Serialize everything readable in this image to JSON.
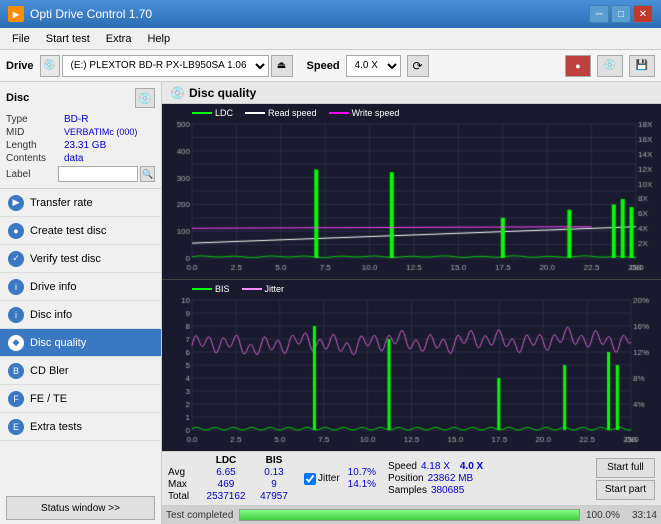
{
  "titleBar": {
    "title": "Opti Drive Control 1.70",
    "icon": "ODC",
    "controls": [
      "minimize",
      "maximize",
      "close"
    ]
  },
  "menuBar": {
    "items": [
      "File",
      "Start test",
      "Extra",
      "Help"
    ]
  },
  "driveBar": {
    "label": "Drive",
    "driveValue": "(E:)  PLEXTOR BD-R  PX-LB950SA 1.06",
    "speedLabel": "Speed",
    "speedValue": "4.0 X"
  },
  "discPanel": {
    "title": "Disc",
    "fields": [
      {
        "label": "Type",
        "value": "BD-R",
        "color": "blue"
      },
      {
        "label": "MID",
        "value": "VERBATIMc (000)",
        "color": "blue"
      },
      {
        "label": "Length",
        "value": "23.31 GB",
        "color": "blue"
      },
      {
        "label": "Contents",
        "value": "data",
        "color": "blue"
      },
      {
        "label": "Label",
        "value": "",
        "type": "input"
      }
    ]
  },
  "navItems": [
    {
      "label": "Transfer rate",
      "icon": "▶"
    },
    {
      "label": "Create test disc",
      "icon": "●"
    },
    {
      "label": "Verify test disc",
      "icon": "✓"
    },
    {
      "label": "Drive info",
      "icon": "i"
    },
    {
      "label": "Disc info",
      "icon": "i"
    },
    {
      "label": "Disc quality",
      "icon": "◆",
      "active": true
    },
    {
      "label": "CD Bler",
      "icon": "B"
    },
    {
      "label": "FE / TE",
      "icon": "F"
    },
    {
      "label": "Extra tests",
      "icon": "E"
    }
  ],
  "statusBtn": "Status window >>",
  "discQuality": {
    "title": "Disc quality",
    "legend1": [
      {
        "label": "LDC",
        "color": "#00ff00"
      },
      {
        "label": "Read speed",
        "color": "#ffffff"
      },
      {
        "label": "Write speed",
        "color": "#ff00ff"
      }
    ],
    "legend2": [
      {
        "label": "BIS",
        "color": "#00ff00"
      },
      {
        "label": "Jitter",
        "color": "#ff88ff"
      }
    ]
  },
  "statsBar": {
    "columns": [
      {
        "header": "LDC",
        "avg": "6.65",
        "max": "469",
        "total": "2537162"
      },
      {
        "header": "BIS",
        "avg": "0.13",
        "max": "9",
        "total": "47957"
      }
    ],
    "jitter": {
      "label": "Jitter",
      "avg": "10.7%",
      "max": "14.1%",
      "checked": true
    },
    "speed": {
      "label": "Speed",
      "value": "4.18 X"
    },
    "position": {
      "label": "Position",
      "value": "23862 MB"
    },
    "samples": {
      "label": "Samples",
      "value": "380685"
    },
    "buttons": [
      "Start full",
      "Start part"
    ]
  },
  "progressBar": {
    "percent": 100,
    "percentText": "100.0%",
    "time": "33:14",
    "statusText": "Test completed"
  }
}
